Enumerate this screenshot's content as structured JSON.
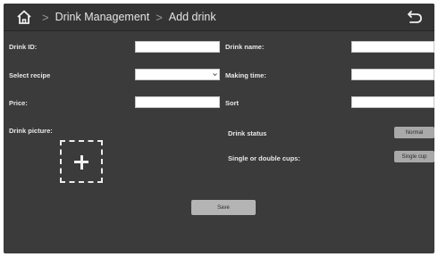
{
  "header": {
    "breadcrumb": [
      "Drink Management",
      "Add drink"
    ]
  },
  "form": {
    "drink_id_label": "Drink ID:",
    "drink_id_value": "",
    "drink_name_label": "Drink name:",
    "drink_name_value": "",
    "select_recipe_label": "Select recipe",
    "select_recipe_value": "",
    "making_time_label": "Making time:",
    "making_time_value": "",
    "price_label": "Price:",
    "price_value": "",
    "sort_label": "Sort",
    "sort_value": "",
    "drink_picture_label": "Drink picture:",
    "drink_status_label": "Drink status",
    "drink_status_value": "Normal",
    "cup_label": "Single or double cups:",
    "cup_value": "Single cup",
    "save_label": "Save"
  },
  "icons": {
    "home": "home-icon",
    "back": "back-arrow-icon",
    "upload": "plus-icon"
  },
  "colors": {
    "background": "#3b3b3b",
    "header": "#343434",
    "button": "#a9a9a9"
  }
}
